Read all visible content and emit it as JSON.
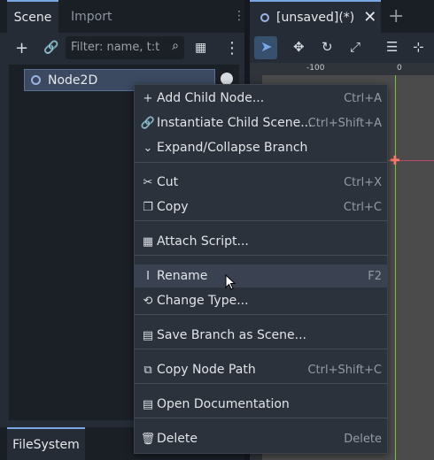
{
  "tabs_left": {
    "scene": "Scene",
    "import": "Import"
  },
  "tabs_right": {
    "unsaved": "[unsaved](*)"
  },
  "scene_toolbar": {
    "filter_placeholder": "Filter: name, t:t"
  },
  "tree": {
    "root_node": "Node2D"
  },
  "bottom": {
    "filesystem": "FileSystem"
  },
  "ruler": {
    "minus100": "-100",
    "zero": "0"
  },
  "menu": {
    "items": [
      {
        "label": "Add Child Node...",
        "shortcut": "Ctrl+A",
        "icon": "plus-icon"
      },
      {
        "label": "Instantiate Child Scene...",
        "shortcut": "Ctrl+Shift+A",
        "icon": "link-icon"
      },
      {
        "label": "Expand/Collapse Branch",
        "shortcut": "",
        "icon": "chevron-down-icon"
      },
      {
        "label": "Cut",
        "shortcut": "Ctrl+X",
        "icon": "scissors-icon"
      },
      {
        "label": "Copy",
        "shortcut": "Ctrl+C",
        "icon": "copy-icon"
      },
      {
        "label": "Attach Script...",
        "shortcut": "",
        "icon": "script-add-icon"
      },
      {
        "label": "Rename",
        "shortcut": "F2",
        "icon": "text-cursor-icon"
      },
      {
        "label": "Change Type...",
        "shortcut": "",
        "icon": "reload-icon"
      },
      {
        "label": "Save Branch as Scene...",
        "shortcut": "",
        "icon": "clapper-icon"
      },
      {
        "label": "Copy Node Path",
        "shortcut": "Ctrl+Shift+C",
        "icon": "copy-path-icon"
      },
      {
        "label": "Open Documentation",
        "shortcut": "",
        "icon": "doc-icon"
      },
      {
        "label": "Delete",
        "shortcut": "Delete",
        "icon": "trash-icon"
      }
    ],
    "highlighted": "Rename"
  }
}
